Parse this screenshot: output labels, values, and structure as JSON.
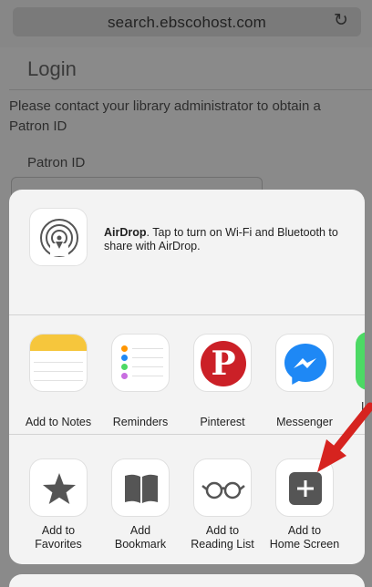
{
  "browser": {
    "address": "search.ebscohost.com",
    "reload_icon": "reload-icon"
  },
  "page": {
    "title": "Login",
    "message": "Please contact your library administrator to obtain a Patron ID",
    "field_label": "Patron ID"
  },
  "share_sheet": {
    "airdrop": {
      "title": "AirDrop",
      "description": ". Tap to turn on Wi-Fi and Bluetooth to share with AirDrop."
    },
    "apps": [
      {
        "label": "Add to Notes",
        "icon": "notes-icon"
      },
      {
        "label": "Reminders",
        "icon": "reminders-icon"
      },
      {
        "label": "Pinterest",
        "icon": "pinterest-icon"
      },
      {
        "label": "Messenger",
        "icon": "messenger-icon"
      }
    ],
    "actions": [
      {
        "line1": "Add to",
        "line2": "Favorites",
        "icon": "star-icon"
      },
      {
        "line1": "Add",
        "line2": "Bookmark",
        "icon": "book-icon"
      },
      {
        "line1": "Add to",
        "line2": "Reading List",
        "icon": "glasses-icon"
      },
      {
        "line1": "Add to",
        "line2": "Home Screen",
        "icon": "plus-icon"
      }
    ],
    "pinterest_glyph": "P"
  },
  "colors": {
    "arrow": "#d6231f",
    "notes_yellow": "#f6c63c",
    "pinterest_red": "#cb2027",
    "messenger_blue": "#1e88f5"
  }
}
